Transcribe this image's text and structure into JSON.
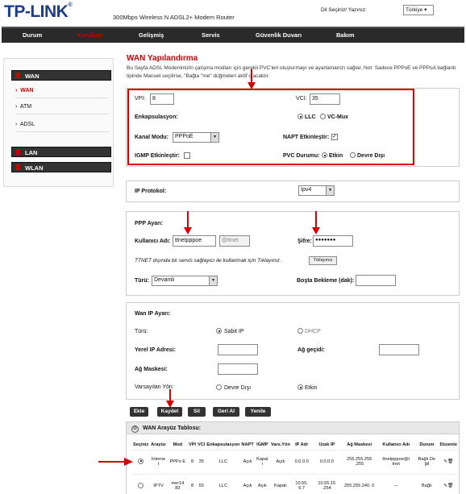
{
  "header": {
    "logo": "TP-LINK",
    "logo_mark": "®",
    "model": "300Mbps Wireless N ADSL2+ Modem Router",
    "language_label": "Dil Seçiniz/ Yazınız:",
    "language_value": "Türkiye"
  },
  "nav": {
    "items": [
      "Durum",
      "Kurulum",
      "Gelişmiş",
      "Servis",
      "Güvenlik Duvarı",
      "Bakım"
    ],
    "active": "Kurulum"
  },
  "sidebar": {
    "cat_wan": "WAN",
    "sub_wan": "WAN",
    "sub_atm": "ATM",
    "sub_adsl": "ADSL",
    "cat_lan": "LAN",
    "cat_wlan": "WLAN"
  },
  "main": {
    "title": "WAN Yapılandırma",
    "description": "Bu Sayfa ADSL Modeminizin çalışma modları için gerekli PVC'leri oluşturmayı ve ayarlamanızı sağlar. Not: Sadece PPPoE ve PPPoA bağlantı tipinde Manuel seçilirse, \"Bağla                          \"me\" düğmeleri aktif olacaktır.",
    "pvc": {
      "vpi_label": "VPI:",
      "vpi_value": "8",
      "vci_label": "VCI:",
      "vci_value": "35",
      "encap_label": "Enkapsulasyon:",
      "encap_llc": "LLC",
      "encap_vcmux": "VC-Mux",
      "channel_label": "Kanal Modu:",
      "channel_value": "PPPoE",
      "napt_label": "NAPT Etkinleştir:",
      "igmp_label": "IGMP Etkinleştir:",
      "pvc_status_label": "PVC Durumu:",
      "pvc_on": "Etkin",
      "pvc_off": "Devre Dışı"
    },
    "ip": {
      "label": "IP Protokol:",
      "value": "Ipv4"
    },
    "ppp": {
      "title": "PPP Ayarı:",
      "user_label": "Kullanıcı Adı:",
      "user_value": "ttnetpppoe",
      "user_suffix": "@ttnet",
      "pass_label": "Şifre:",
      "pass_value": "●●●●●●●",
      "note": "TTNET dışında bir servis sağlayıcı ile kullanmak için Tıklayınız.",
      "click_btn": "Tıklayınız",
      "type_label": "Türü:",
      "type_value": "Devamlı",
      "idle_label": "Boşta Bekleme (dak):"
    },
    "wanip": {
      "title": "Wan IP Ayarı:",
      "type_label": "Türü:",
      "static": "Sabit IP",
      "dhcp": "DHCP",
      "local_ip_label": "Yerel IP Adresi:",
      "gateway_label": "Ağ geçidi:",
      "mask_label": "Ağ Maskesi:",
      "default_route_label": "Varsayılan Yön:",
      "route_off": "Devre Dışı",
      "route_on": "Etkin"
    },
    "buttons": {
      "add": "Ekle",
      "save": "Kaydet",
      "delete": "Sil",
      "cancel": "Geri Al",
      "refresh": "Yenile"
    },
    "table": {
      "title": "WAN Arayüz Tablosu:",
      "headers": [
        "Seçiniz",
        "Arayüz",
        "Mod",
        "VPI",
        "VCI",
        "Enkapsulasyon",
        "NAPT",
        "IGMP",
        "Vars.Yön",
        "IP Adr",
        "Uzak IP",
        "Ağ Maskesi",
        "Kullanıcı Adı",
        "Durum",
        "Düzenle"
      ],
      "rows": [
        [
          "",
          "Interne t",
          "PPPo E",
          "8",
          "35",
          "LLC",
          "Açık",
          "Kapal ı",
          "Açık",
          "0.0.0.0",
          "0.0.0.0",
          "255.255.255 .255",
          "ttnetpppoe@t tnet",
          "Bağlı De ğil",
          ""
        ],
        [
          "",
          "IPTV",
          "mer14 83",
          "8",
          "55",
          "LLC",
          "Açık",
          "Açık",
          "Kapalı",
          "10.55. 6.7",
          "10.55.15 .254",
          "255.255.240. 0",
          "---",
          "Bağlı",
          ""
        ]
      ]
    }
  },
  "colors": {
    "accent": "#cc0000",
    "nav_bg": "#2a2a2a",
    "highlight_box": "#d40000"
  }
}
